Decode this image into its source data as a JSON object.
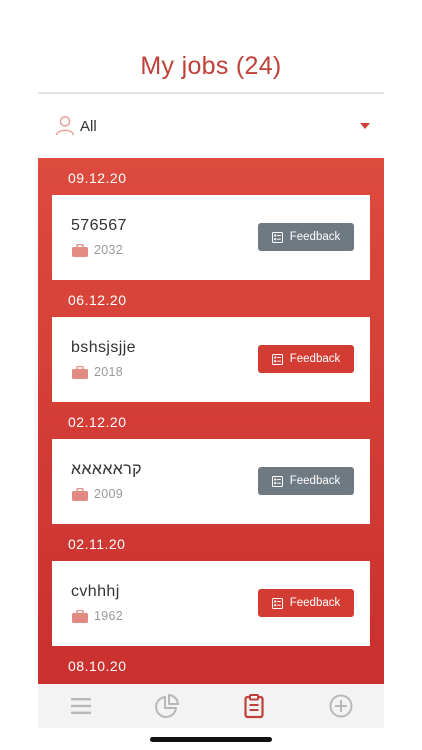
{
  "header": {
    "title": "My jobs (24)"
  },
  "filter": {
    "label": "All",
    "icon": "user-icon"
  },
  "jobs": [
    {
      "date": "09.12.20",
      "name": "576567",
      "number": "2032",
      "feedback_label": "Feedback",
      "button_style": "gray"
    },
    {
      "date": "06.12.20",
      "name": "bshsjsjje",
      "number": "2018",
      "feedback_label": "Feedback",
      "button_style": "red"
    },
    {
      "date": "02.12.20",
      "name": "קראאאאא",
      "number": "2009",
      "feedback_label": "Feedback",
      "button_style": "gray"
    },
    {
      "date": "02.11.20",
      "name": "cvhhhj",
      "number": "1962",
      "feedback_label": "Feedback",
      "button_style": "red"
    },
    {
      "date": "08.10.20"
    }
  ],
  "tabbar": {
    "items": [
      {
        "icon": "menu-icon",
        "active": false
      },
      {
        "icon": "pie-chart-icon",
        "active": false
      },
      {
        "icon": "clipboard-icon",
        "active": true
      },
      {
        "icon": "add-circle-icon",
        "active": false
      }
    ]
  },
  "colors": {
    "accent": "#c0403a",
    "gray_button": "#6f7982",
    "red_button": "#d33c33",
    "inactive_icon": "#b8b8b8"
  }
}
